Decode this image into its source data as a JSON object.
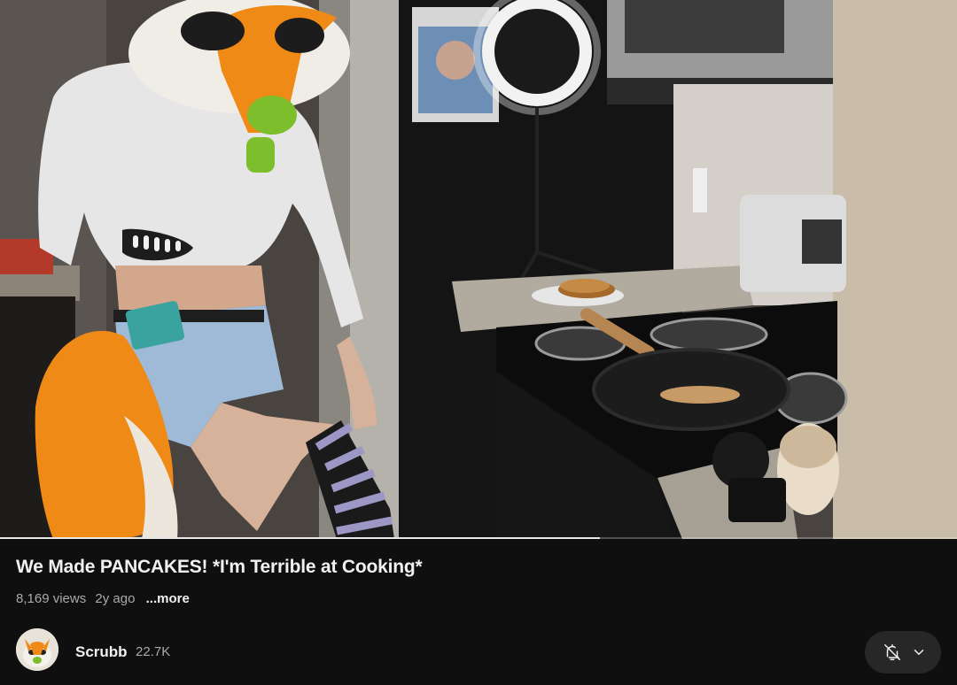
{
  "video": {
    "progress_fraction": 0.627
  },
  "video_info": {
    "title": "We Made PANCAKES! *I'm Terrible at Cooking*",
    "views": "8,169 views",
    "age": "2y ago",
    "more_label": "...more"
  },
  "channel": {
    "name": "Scrubb",
    "subscribers": "22.7K"
  },
  "subscribe_button": {
    "icons": [
      "bell-off-icon",
      "chevron-down-icon"
    ]
  },
  "colors": {
    "background": "#0f0f0f",
    "secondary_text": "#aaaaaa",
    "button_bg": "#272727"
  }
}
